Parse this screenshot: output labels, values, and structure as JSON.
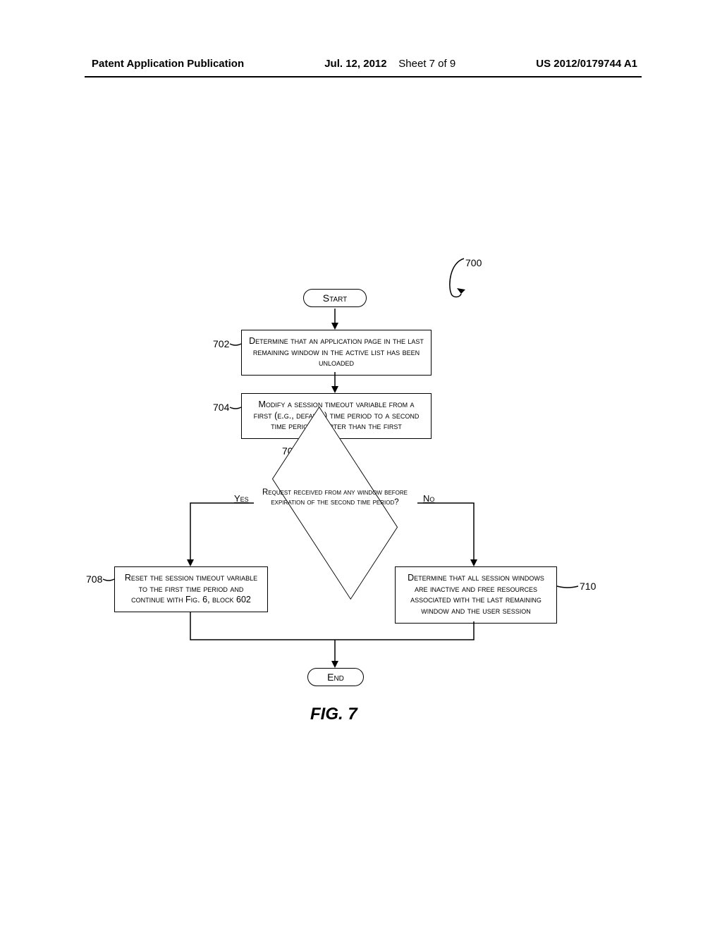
{
  "header": {
    "publication": "Patent Application Publication",
    "date": "Jul. 12, 2012",
    "sheet": "Sheet 7 of 9",
    "pubnum": "US 2012/0179744 A1"
  },
  "flow": {
    "ref_overall": "700",
    "start": "Start",
    "end": "End",
    "step702_ref": "702",
    "step702": "Determine that an application page in the last remaining window in the active list has been unloaded",
    "step704_ref": "704",
    "step704": "Modify a session timeout variable from a first (e.g., default) time period to a second time period shorter than the first",
    "step706_ref": "706",
    "step706": "Request received from any window before expiration of the second time period?",
    "yes": "Yes",
    "no": "No",
    "step708_ref": "708",
    "step708": "Reset the session timeout variable to the first time period and continue with Fig. 6, block 602",
    "step710_ref": "710",
    "step710": "Determine that all session windows are inactive and free resources associated with the last remaining window and the user session"
  },
  "figure_label": "FIG. 7"
}
